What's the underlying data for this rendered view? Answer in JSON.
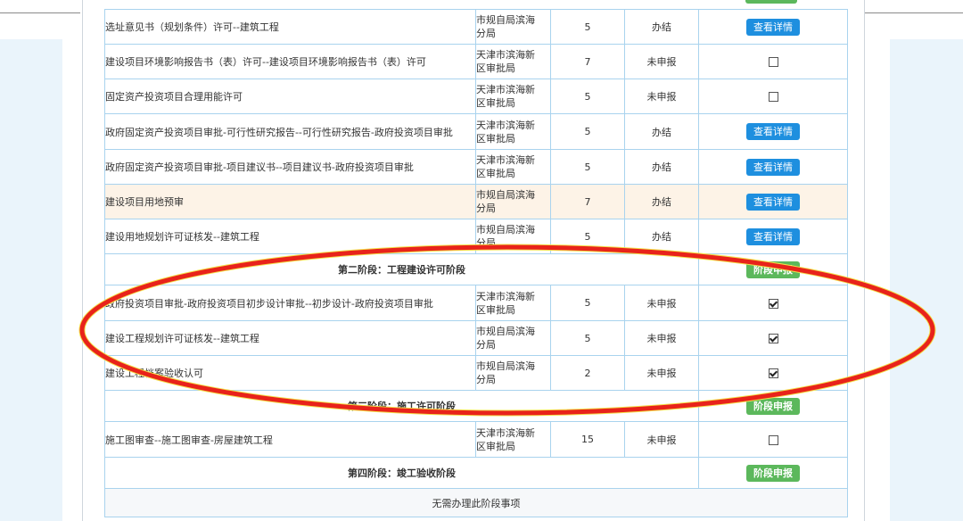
{
  "rows": [
    {
      "name": "选址意见书（规划条件）许可--建筑工程",
      "org": [
        "市规自局滨海",
        "分局"
      ],
      "days": "5",
      "status": "办结",
      "action": "button",
      "action_label": "查看详情"
    },
    {
      "name": "建设项目环境影响报告书（表）许可--建设项目环境影响报告书（表）许可",
      "org": [
        "天津市滨海新",
        "区审批局"
      ],
      "days": "7",
      "status": "未申报",
      "action": "checkbox",
      "checked": false
    },
    {
      "name": "固定资产投资项目合理用能许可",
      "org": [
        "天津市滨海新",
        "区审批局"
      ],
      "days": "5",
      "status": "未申报",
      "action": "checkbox",
      "checked": false
    },
    {
      "name": "政府固定资产投资项目审批-可行性研究报告--可行性研究报告-政府投资项目审批",
      "org": [
        "天津市滨海新",
        "区审批局"
      ],
      "days": "5",
      "status": "办结",
      "action": "button",
      "action_label": "查看详情"
    },
    {
      "name": "政府固定资产投资项目审批-项目建议书--项目建议书-政府投资项目审批",
      "org": [
        "天津市滨海新",
        "区审批局"
      ],
      "days": "5",
      "status": "办结",
      "action": "button",
      "action_label": "查看详情"
    },
    {
      "name": "建设项目用地预审",
      "org": [
        "市规自局滨海",
        "分局"
      ],
      "days": "7",
      "status": "办结",
      "action": "button",
      "action_label": "查看详情",
      "highlight": true
    },
    {
      "name": "建设用地规划许可证核发--建筑工程",
      "org": [
        "市规自局滨海",
        "分局"
      ],
      "days": "5",
      "status": "办结",
      "action": "button",
      "action_label": "查看详情"
    }
  ],
  "stage2": {
    "title": "第二阶段：工程建设许可阶段",
    "button": "阶段申报"
  },
  "stage2_rows": [
    {
      "name": "政府投资项目审批-政府投资项目初步设计审批--初步设计-政府投资项目审批",
      "org": [
        "天津市滨海新",
        "区审批局"
      ],
      "days": "5",
      "status": "未申报",
      "checked": true
    },
    {
      "name": "建设工程规划许可证核发--建筑工程",
      "org": [
        "市规自局滨海",
        "分局"
      ],
      "days": "5",
      "status": "未申报",
      "checked": true
    },
    {
      "name": "建设工程档案验收认可",
      "org": [
        "市规自局滨海",
        "分局"
      ],
      "days": "2",
      "status": "未申报",
      "checked": true
    }
  ],
  "stage3": {
    "title": "第三阶段：施工许可阶段",
    "button": "阶段申报"
  },
  "stage3_rows": [
    {
      "name": "施工图审查--施工图审查-房屋建筑工程",
      "org": [
        "天津市滨海新",
        "区审批局"
      ],
      "days": "15",
      "status": "未申报",
      "checked": false
    }
  ],
  "stage4": {
    "title": "第四阶段：竣工验收阶段",
    "button": "阶段申报",
    "empty_text": "无需办理此阶段事项"
  },
  "colors": {
    "primary": "#1e8fdf",
    "success": "#5cb85c",
    "border": "#a9d3ee",
    "annotation": "#e8231b"
  }
}
